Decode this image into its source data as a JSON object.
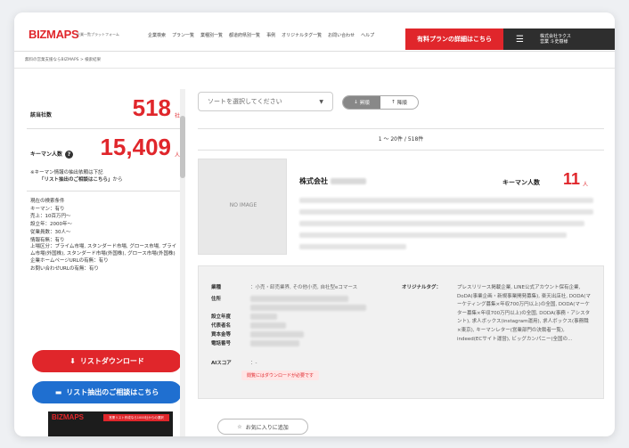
{
  "header": {
    "logo": "BIZMAPS",
    "logo_sub": "企業一覧プラットフォーム",
    "nav": [
      "企業検索",
      "プラン一覧",
      "業種別一覧",
      "都道府県別一覧",
      "事例",
      "オリジナルタグ一覧",
      "お問い合わせ",
      "ヘルプ"
    ],
    "cta": "有料プランの詳細はこちら",
    "account_company": "株式会社ラクス",
    "account_user": "営業 斗史樹様"
  },
  "breadcrumb": "無料の営業支援ならBIZMAPS  >  検索結果",
  "sidebar": {
    "hits_label": "該当社数",
    "hits_value": "518",
    "hits_unit": "社",
    "keyman_label": "キーマン人数",
    "keyman_value": "15,409",
    "keyman_unit": "人",
    "note_line1": "※キーマン情報の抽出依頼は下記",
    "note_link": "「リスト抽出のご相談はこちら」",
    "note_tail": "から",
    "conditions_title": "現在の検索条件",
    "conditions": [
      "キーマン：有り",
      "売上：10百万円〜",
      "設立年：2000年〜",
      "従業員数：30人〜",
      "情報有無：有り",
      "上場区分：プライム市場, スタンダード市場, グロース市場, プライム市場(外国株), スタンダード市場(外国株), グロース市場(外国株)",
      "企業ホームページURLの有無：有り",
      "お問い合わせURLの有無：有り"
    ],
    "download_button": "リストダウンロード",
    "consult_button": "リスト抽出のご相談はこちら",
    "banner_logo": "BIZMAPS",
    "banner_tag": "営業リスト作成なら1000社からの選択"
  },
  "main": {
    "sort_placeholder": "ソートを選択してください",
    "toggle_asc": "昇順",
    "toggle_desc": "降順",
    "count_text": "1 〜 20件 / 518件",
    "card": {
      "image_text": "NO IMAGE",
      "company_prefix": "株式会社",
      "keyman_label": "キーマン人数",
      "keyman_value": "11",
      "keyman_unit": "人",
      "info_keys": [
        "業種",
        "住所",
        "設立年度",
        "代表者名",
        "資本金等",
        "電話番号",
        "AIスコア"
      ],
      "industry_value": "：小売・卸売業界, その他小売, 自社型eコマース",
      "ai_value": "：-",
      "warn_text": "閲覧にはダウンロードが必要です",
      "tag_label": "オリジナルタグ：",
      "tags_text": "プレスリリース掲載企業, LINE公式アカウント保有企業, DoDA(事業企画・新規事業開発募集), 楽天出店社, DODA(マーケティング募集×年収700万円以上)の全国, DODA(マーケター募集×年収700万円以上)の全国, DODA(事務・アシスタント), 求人ボックス(instagram運用), 求人ボックス(事務職×東京), キーマンレター(営業部門の決裁者一覧), indeed(ECサイト運営), ビッグカンパニー(全国の…",
      "fav_button": "お気に入りに追加"
    }
  }
}
